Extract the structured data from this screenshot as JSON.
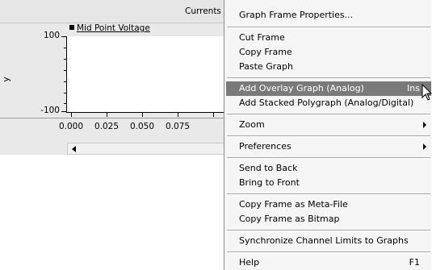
{
  "graph": {
    "title": "Currents ar",
    "legend": {
      "label": "Mid Point Voltage"
    },
    "y_axis_label": "y",
    "y_ticks": [
      "100",
      "-100"
    ],
    "x_ticks": [
      "0.000",
      "0.025",
      "0.050",
      "0.075"
    ]
  },
  "chart_data": {
    "type": "line",
    "title": "",
    "xlabel": "",
    "ylabel": "y",
    "ylim": [
      -100,
      100
    ],
    "x_tick_labels": [
      "0.000",
      "0.025",
      "0.050",
      "0.075"
    ],
    "series": [
      {
        "name": "Mid Point Voltage",
        "values": []
      }
    ]
  },
  "context_menu": {
    "items": [
      {
        "label": "Graph Frame Properties..."
      },
      {
        "label": "Cut Frame"
      },
      {
        "label": "Copy Frame"
      },
      {
        "label": "Paste Graph"
      },
      {
        "label": "Add Overlay Graph (Analog)",
        "shortcut": "Ins",
        "highlighted": true
      },
      {
        "label": "Add Stacked Polygraph (Analog/Digital)"
      },
      {
        "label": "Zoom",
        "submenu": true
      },
      {
        "label": "Preferences",
        "submenu": true
      },
      {
        "label": "Send to Back"
      },
      {
        "label": "Bring to Front"
      },
      {
        "label": "Copy Frame as Meta-File"
      },
      {
        "label": "Copy Frame as Bitmap"
      },
      {
        "label": "Synchronize Channel Limits to Graphs"
      },
      {
        "label": "Help",
        "shortcut": "F1"
      }
    ]
  },
  "colors": {
    "frame_background": "#e9e9e9",
    "menu_background": "#f5f5f5",
    "menu_highlight": "#7a7a7a"
  }
}
